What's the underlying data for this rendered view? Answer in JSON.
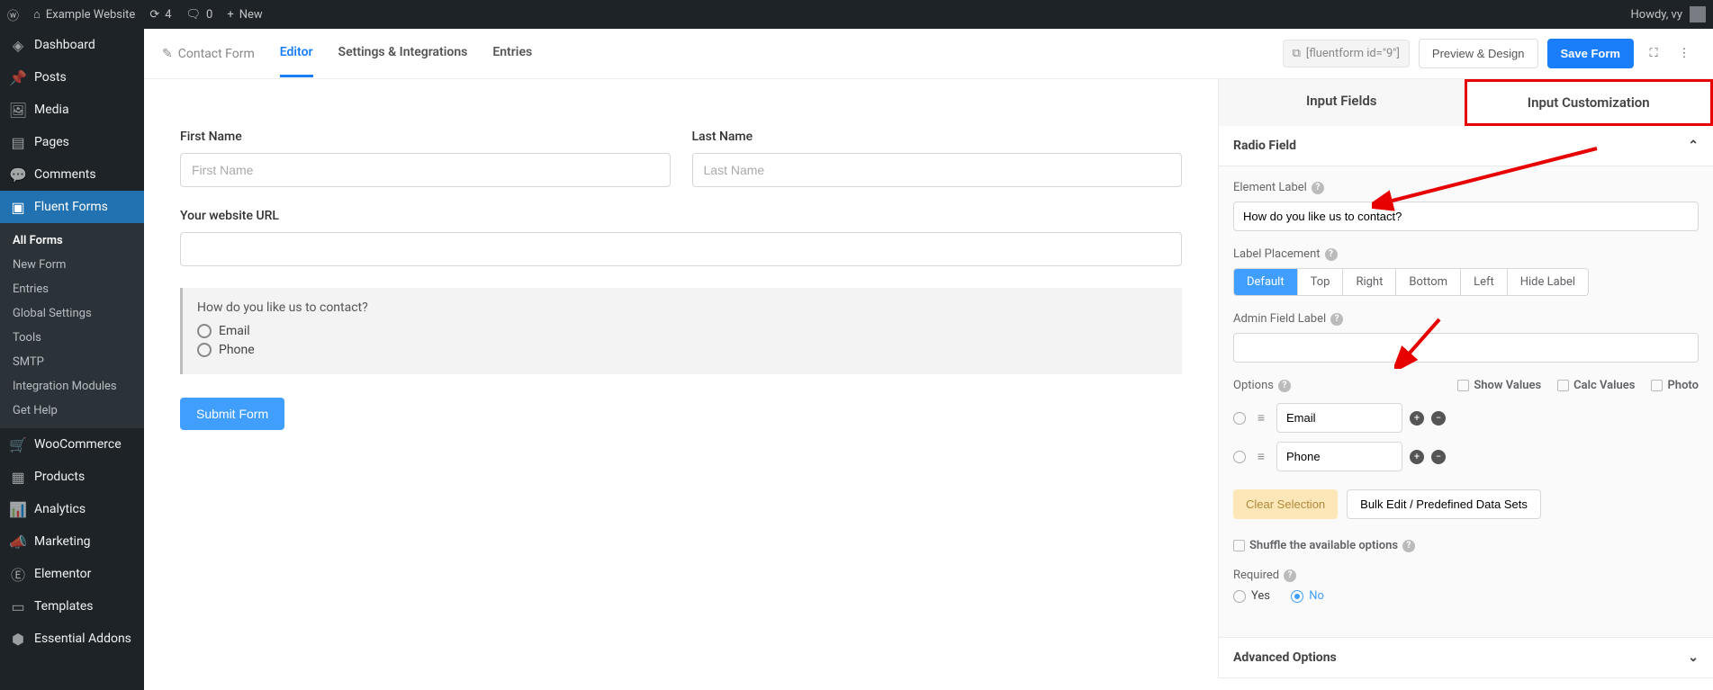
{
  "adminbar": {
    "site_name": "Example Website",
    "refresh_count": "4",
    "comments_count": "0",
    "new_label": "New",
    "greeting": "Howdy, vy"
  },
  "sidebar": {
    "items": [
      {
        "icon": "◈",
        "label": "Dashboard"
      },
      {
        "icon": "📌",
        "label": "Posts"
      },
      {
        "icon": "🖼",
        "label": "Media"
      },
      {
        "icon": "▤",
        "label": "Pages"
      },
      {
        "icon": "💬",
        "label": "Comments"
      },
      {
        "icon": "▣",
        "label": "Fluent Forms",
        "active": true
      },
      {
        "icon": "🛒",
        "label": "WooCommerce"
      },
      {
        "icon": "▦",
        "label": "Products"
      },
      {
        "icon": "📊",
        "label": "Analytics"
      },
      {
        "icon": "📣",
        "label": "Marketing"
      },
      {
        "icon": "Ⓔ",
        "label": "Elementor"
      },
      {
        "icon": "▭",
        "label": "Templates"
      },
      {
        "icon": "⬢",
        "label": "Essential Addons"
      }
    ],
    "submenu": [
      "All Forms",
      "New Form",
      "Entries",
      "Global Settings",
      "Tools",
      "SMTP",
      "Integration Modules",
      "Get Help"
    ]
  },
  "topbar": {
    "form_name": "Contact Form",
    "tabs": [
      "Editor",
      "Settings & Integrations",
      "Entries"
    ],
    "active_tab": 0,
    "shortcode": "[fluentform id=\"9\"]",
    "preview_label": "Preview & Design",
    "save_label": "Save Form"
  },
  "canvas": {
    "first_name_label": "First Name",
    "first_name_ph": "First Name",
    "last_name_label": "Last Name",
    "last_name_ph": "Last Name",
    "url_label": "Your website URL",
    "radio_question": "How do you like us to contact?",
    "radio_options": [
      "Email",
      "Phone"
    ],
    "submit_label": "Submit Form"
  },
  "panel": {
    "tabs": [
      "Input Fields",
      "Input Customization"
    ],
    "section_title": "Radio Field",
    "element_label_title": "Element Label",
    "element_label_value": "How do you like us to contact?",
    "label_placement_title": "Label Placement",
    "placements": [
      "Default",
      "Top",
      "Right",
      "Bottom",
      "Left",
      "Hide Label"
    ],
    "admin_field_title": "Admin Field Label",
    "options_title": "Options",
    "show_values": "Show Values",
    "calc_values": "Calc Values",
    "photo": "Photo",
    "option_items": [
      "Email",
      "Phone"
    ],
    "clear_selection": "Clear Selection",
    "bulk_edit": "Bulk Edit / Predefined Data Sets",
    "shuffle_label": "Shuffle the available options",
    "required_title": "Required",
    "yes": "Yes",
    "no": "No",
    "advanced_title": "Advanced Options"
  }
}
